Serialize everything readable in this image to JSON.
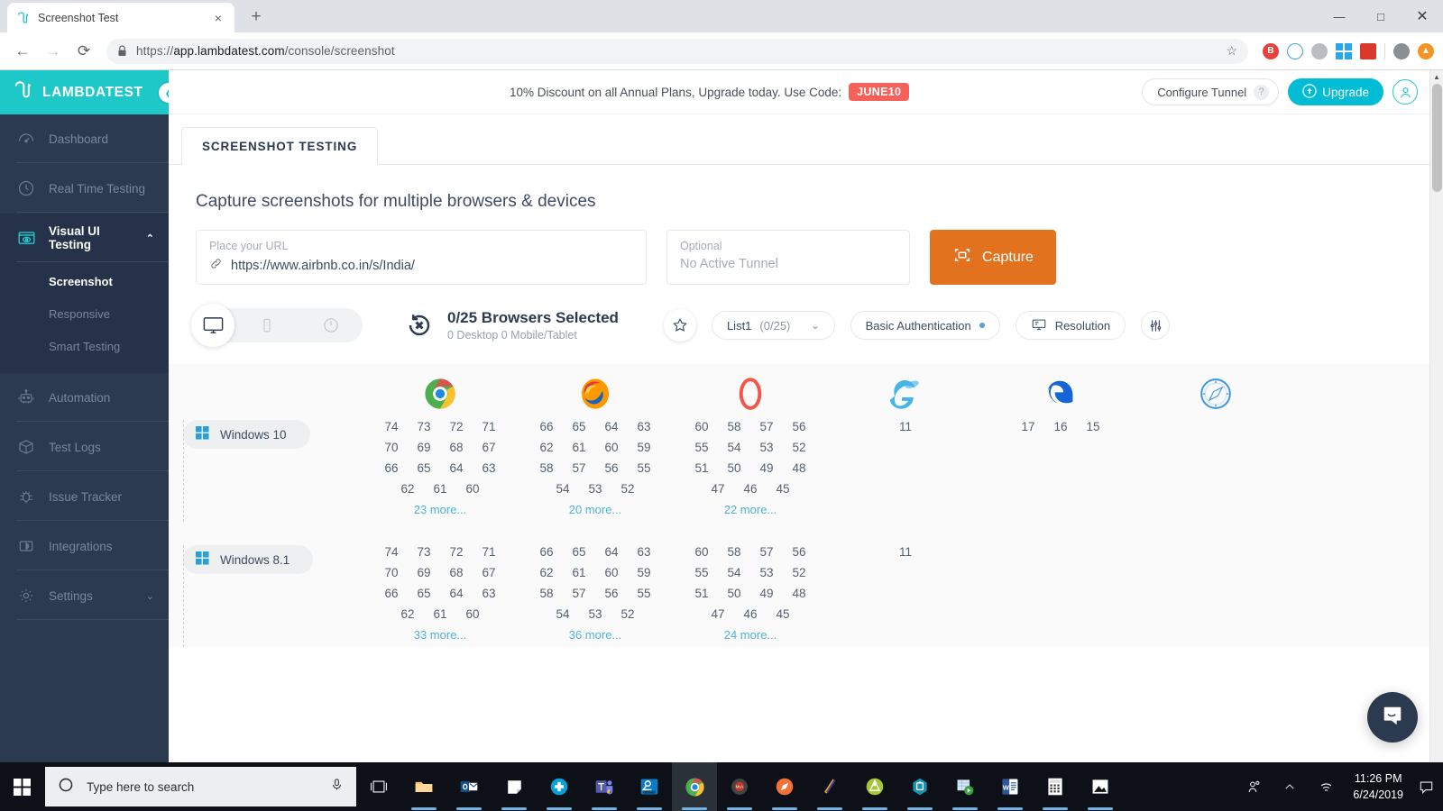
{
  "browser": {
    "tab": {
      "title": "Screenshot Test",
      "favicon": "lambdatest-favicon",
      "close_label": "×"
    },
    "new_tab_label": "+",
    "window_controls": {
      "minimize": "—",
      "maximize": "□",
      "close": "✕"
    },
    "nav": {
      "back": "←",
      "forward": "→",
      "reload": "⟳"
    },
    "url": {
      "scheme": "https://",
      "host": "app.lambdatest.com",
      "path": "/console/screenshot",
      "lock_icon": "lock-icon"
    },
    "bookmark_star": "☆",
    "extensions": [
      "bitwarden-icon",
      "qwant-icon",
      "ghostery-icon",
      "windows-store-icon",
      "zotero-icon",
      "profile-avatar-icon",
      "orange-arrow-icon"
    ]
  },
  "sidebar": {
    "brand": "LAMBDATEST",
    "collapse_icon": "chevron-left-icon",
    "items": [
      {
        "label": "Dashboard",
        "icon": "speedometer-icon",
        "active": false
      },
      {
        "label": "Real Time Testing",
        "icon": "clock-icon",
        "active": false
      },
      {
        "label": "Visual UI Testing",
        "icon": "eye-monitor-icon",
        "active": true,
        "caret": "⌃"
      },
      {
        "label": "Automation",
        "icon": "robot-icon",
        "active": false
      },
      {
        "label": "Test Logs",
        "icon": "box-icon",
        "active": false
      },
      {
        "label": "Issue Tracker",
        "icon": "bug-icon",
        "active": false
      },
      {
        "label": "Integrations",
        "icon": "puzzle-icon",
        "active": false
      },
      {
        "label": "Settings",
        "icon": "gear-icon",
        "active": false,
        "caret": "⌄"
      }
    ],
    "subitems": [
      {
        "label": "Screenshot",
        "active": true
      },
      {
        "label": "Responsive",
        "active": false
      },
      {
        "label": "Smart Testing",
        "active": false
      }
    ]
  },
  "topbar": {
    "promo_text": "10% Discount on all Annual Plans, Upgrade today. Use Code:",
    "promo_code": "JUNE10",
    "configure_tunnel": "Configure Tunnel",
    "help_label": "?",
    "upgrade": "Upgrade",
    "avatar": "user-avatar-icon"
  },
  "page": {
    "tab_label": "SCREENSHOT TESTING",
    "title": "Capture screenshots for multiple browsers & devices",
    "url_field": {
      "label": "Place your URL",
      "value": "https://www.airbnb.co.in/s/India/"
    },
    "tunnel_field": {
      "label": "Optional",
      "value": "No Active Tunnel"
    },
    "capture_button": "Capture"
  },
  "toolbar": {
    "device_types": [
      {
        "name": "desktop",
        "icon": "monitor-icon",
        "active": true
      },
      {
        "name": "mobile",
        "icon": "phone-icon",
        "active": false
      },
      {
        "name": "tablet",
        "icon": "tablet-icon",
        "active": false
      }
    ],
    "reset_icon": "reset-x-icon",
    "selection_count": "0/25 Browsers Selected",
    "selection_detail": "0 Desktop 0 Mobile/Tablet",
    "favorite_icon": "star-icon",
    "list_label": "List1",
    "list_count": "(0/25)",
    "list_caret": "⌄",
    "basic_auth": "Basic Authentication",
    "resolution": "Resolution",
    "settings_icon": "sliders-icon"
  },
  "matrix": {
    "browsers": [
      {
        "name": "Chrome",
        "icon": "chrome-icon"
      },
      {
        "name": "Firefox",
        "icon": "firefox-icon"
      },
      {
        "name": "Opera",
        "icon": "opera-icon"
      },
      {
        "name": "Internet Explorer",
        "icon": "ie-icon"
      },
      {
        "name": "Microsoft Edge",
        "icon": "edge-icon"
      },
      {
        "name": "Safari",
        "icon": "safari-icon"
      }
    ],
    "rows": [
      {
        "os": "Windows 10",
        "os_icon": "windows-icon",
        "cells": [
          {
            "versions": [
              [
                "74",
                "73",
                "72",
                "71"
              ],
              [
                "70",
                "69",
                "68",
                "67"
              ],
              [
                "66",
                "65",
                "64",
                "63"
              ],
              [
                "62",
                "61",
                "60"
              ]
            ],
            "more": "23 more..."
          },
          {
            "versions": [
              [
                "66",
                "65",
                "64",
                "63"
              ],
              [
                "62",
                "61",
                "60",
                "59"
              ],
              [
                "58",
                "57",
                "56",
                "55"
              ],
              [
                "54",
                "53",
                "52"
              ]
            ],
            "more": "20 more..."
          },
          {
            "versions": [
              [
                "60",
                "58",
                "57",
                "56"
              ],
              [
                "55",
                "54",
                "53",
                "52"
              ],
              [
                "51",
                "50",
                "49",
                "48"
              ],
              [
                "47",
                "46",
                "45"
              ]
            ],
            "more": "22 more..."
          },
          {
            "versions": [
              [
                "11"
              ]
            ],
            "more": ""
          },
          {
            "versions": [
              [
                "17",
                "16",
                "15"
              ]
            ],
            "more": ""
          },
          {
            "versions": [],
            "more": ""
          }
        ]
      },
      {
        "os": "Windows 8.1",
        "os_icon": "windows-icon",
        "cells": [
          {
            "versions": [
              [
                "74",
                "73",
                "72",
                "71"
              ],
              [
                "70",
                "69",
                "68",
                "67"
              ],
              [
                "66",
                "65",
                "64",
                "63"
              ],
              [
                "62",
                "61",
                "60"
              ]
            ],
            "more": "33 more..."
          },
          {
            "versions": [
              [
                "66",
                "65",
                "64",
                "63"
              ],
              [
                "62",
                "61",
                "60",
                "59"
              ],
              [
                "58",
                "57",
                "56",
                "55"
              ],
              [
                "54",
                "53",
                "52"
              ]
            ],
            "more": "36 more..."
          },
          {
            "versions": [
              [
                "60",
                "58",
                "57",
                "56"
              ],
              [
                "55",
                "54",
                "53",
                "52"
              ],
              [
                "51",
                "50",
                "49",
                "48"
              ],
              [
                "47",
                "46",
                "45"
              ]
            ],
            "more": "24 more..."
          },
          {
            "versions": [
              [
                "11"
              ]
            ],
            "more": ""
          },
          {
            "versions": [],
            "more": ""
          },
          {
            "versions": [],
            "more": ""
          }
        ]
      }
    ]
  },
  "chat": {
    "icon": "intercom-chat-icon"
  },
  "taskbar": {
    "start_icon": "windows-start-icon",
    "search_placeholder": "Type here to search",
    "search_icon": "search-circle-icon",
    "mic_icon": "microphone-icon",
    "items": [
      {
        "name": "task-view-icon",
        "running": false
      },
      {
        "name": "file-explorer-icon",
        "running": true
      },
      {
        "name": "outlook-icon",
        "running": true
      },
      {
        "name": "sticky-notes-icon",
        "running": true
      },
      {
        "name": "health-plus-icon",
        "running": true
      },
      {
        "name": "microsoft-teams-icon",
        "running": true
      },
      {
        "name": "dell-support-icon",
        "running": true
      },
      {
        "name": "chrome-icon",
        "running": true,
        "active": true
      },
      {
        "name": "mcafee-icon",
        "running": true
      },
      {
        "name": "safari-icon",
        "running": true
      },
      {
        "name": "sourcetree-icon",
        "running": true
      },
      {
        "name": "sublime-text-icon",
        "running": true
      },
      {
        "name": "android-studio-icon",
        "running": true
      },
      {
        "name": "clipboard-hex-icon",
        "running": true
      },
      {
        "name": "media-player-icon",
        "running": true
      },
      {
        "name": "word-icon",
        "running": true
      },
      {
        "name": "calculator-icon",
        "running": true
      },
      {
        "name": "photos-icon",
        "running": true
      }
    ],
    "tray": {
      "people_icon": "people-icon",
      "show_hidden_icon": "chevron-up-icon",
      "network_icon": "wifi-icon",
      "time": "11:26 PM",
      "date": "6/24/2019",
      "action_center_icon": "notification-icon"
    }
  }
}
